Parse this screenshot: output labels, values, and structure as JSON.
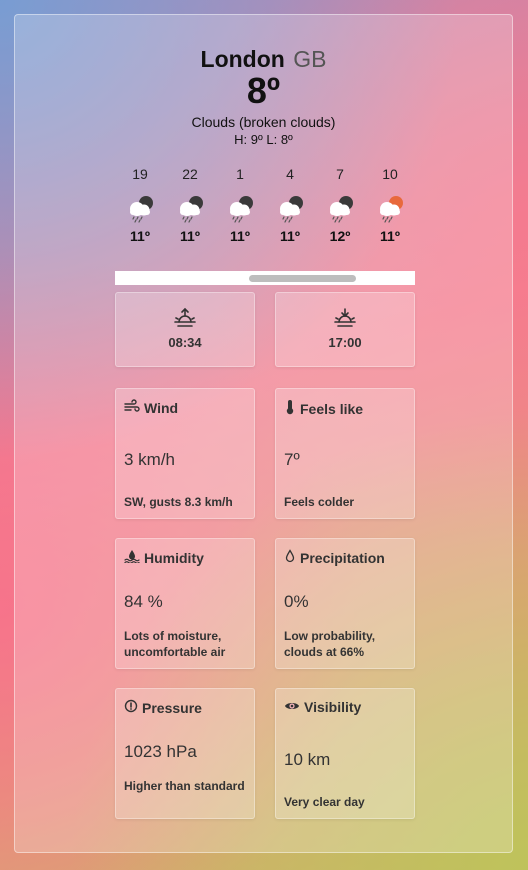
{
  "location": {
    "city": "London",
    "country": "GB"
  },
  "current": {
    "temp": "8º",
    "description": "Clouds (broken clouds)",
    "high_low": "H: 9º L: 8º"
  },
  "hourly": [
    {
      "time": "19",
      "temp": "11º",
      "icon": "rain-cloud-moon-icon"
    },
    {
      "time": "22",
      "temp": "11º",
      "icon": "rain-cloud-moon-icon"
    },
    {
      "time": "1",
      "temp": "11º",
      "icon": "rain-cloud-moon-icon"
    },
    {
      "time": "4",
      "temp": "11º",
      "icon": "rain-cloud-moon-icon"
    },
    {
      "time": "7",
      "temp": "12º",
      "icon": "rain-cloud-moon-icon"
    },
    {
      "time": "10",
      "temp": "11º",
      "icon": "rain-cloud-sun-icon"
    }
  ],
  "sunrise": {
    "time": "08:34",
    "icon": "sunrise-icon"
  },
  "sunset": {
    "time": "17:00",
    "icon": "sunset-icon"
  },
  "stats": {
    "wind": {
      "title": "Wind",
      "value": "3 km/h",
      "note": "SW, gusts 8.3 km/h",
      "icon": "wind-icon"
    },
    "feels_like": {
      "title": "Feels like",
      "value": "7º",
      "note": "Feels colder",
      "icon": "thermometer-icon"
    },
    "humidity": {
      "title": "Humidity",
      "value": "84 %",
      "note": "Lots of moisture, uncomfortable air",
      "icon": "humidity-icon"
    },
    "precipitation": {
      "title": "Precipitation",
      "value": "0%",
      "note": "Low probability, clouds at 66%",
      "icon": "droplet-icon"
    },
    "pressure": {
      "title": "Pressure",
      "value": "1023 hPa",
      "note": "Higher than standard",
      "icon": "gauge-icon"
    },
    "visibility": {
      "title": "Visibility",
      "value": "10 km",
      "note": "Very clear day",
      "icon": "eye-icon"
    }
  },
  "colors": {
    "sun_accent": "#e8693c",
    "cloud": "#ffffff",
    "moon": "#3a3a3a"
  }
}
